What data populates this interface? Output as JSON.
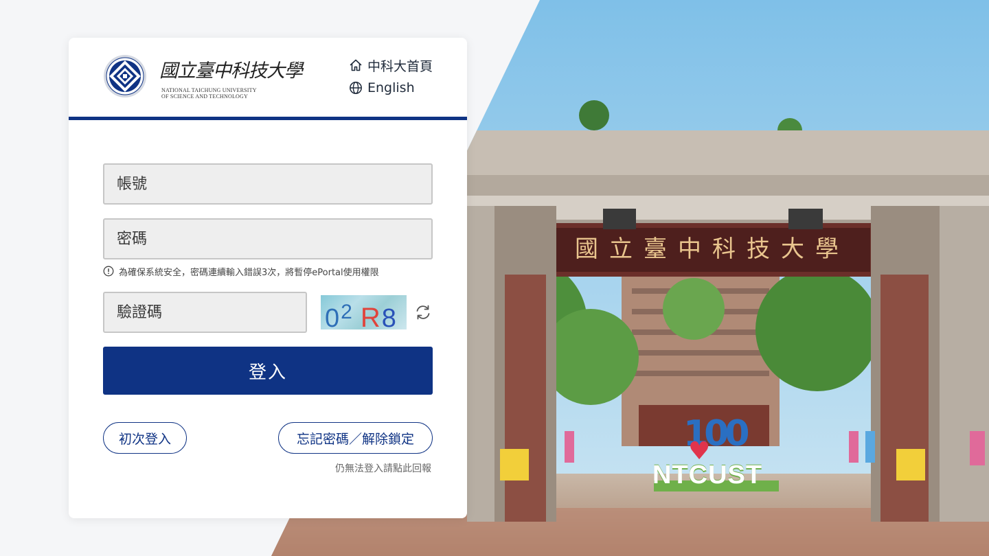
{
  "header": {
    "logo_script_text": "國立臺中科技大學",
    "logo_en_line1": "NATIONAL TAICHUNG UNIVERSITY",
    "logo_en_line2": "OF SCIENCE AND TECHNOLOGY",
    "home_link": "中科大首頁",
    "english_link": "English"
  },
  "form": {
    "account_placeholder": "帳號",
    "password_placeholder": "密碼",
    "lockout_notice": "為確保系統安全，密碼連續輸入錯誤3次，將暫停ePortal使用權限",
    "captcha_placeholder": "驗證碼",
    "captcha_chars": [
      {
        "char": "0",
        "color": "#2e6fb7"
      },
      {
        "char": "2",
        "color": "#2e6fb7"
      },
      {
        "char": "R",
        "color": "#e0443c"
      },
      {
        "char": "8",
        "color": "#2a52b8"
      }
    ],
    "login_button": "登入",
    "first_login_button": "初次登入",
    "forgot_password_button": "忘記密碼／解除鎖定",
    "report_link": "仍無法登入請點此回報"
  },
  "background": {
    "gate_title": "國立臺中科技大學",
    "sign_100": "100",
    "sign_ntcust": "NTCUST"
  },
  "colors": {
    "brand_navy": "#0f3384",
    "field_bg": "#eeeeee",
    "page_bg": "#f5f6f8"
  },
  "icons": {
    "home": "home-icon",
    "globe": "globe-icon",
    "info": "info-circle-icon",
    "refresh": "refresh-icon"
  }
}
